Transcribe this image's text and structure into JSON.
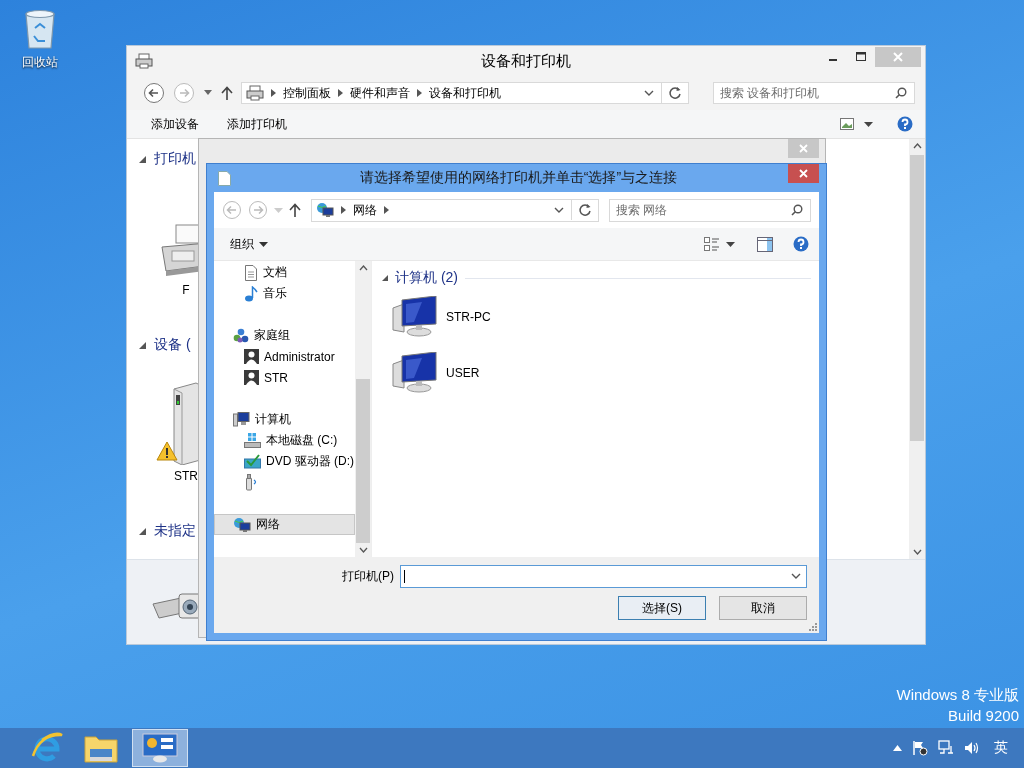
{
  "desktop": {
    "recycle_bin": {
      "label": "回收站"
    },
    "edition": "Windows 8 专业版",
    "build": "Build 9200"
  },
  "main_window": {
    "title": "设备和打印机",
    "breadcrumbs": [
      "控制面板",
      "硬件和声音",
      "设备和打印机"
    ],
    "search": {
      "placeholder": "搜索 设备和打印机"
    },
    "toolbar": [
      "添加设备",
      "添加打印机"
    ],
    "groups": [
      {
        "title": "打印机",
        "expanded": true,
        "items": [
          {
            "kind": "fax",
            "label": "F"
          }
        ]
      },
      {
        "title": "设备 (",
        "expanded": true,
        "items": [
          {
            "kind": "drive",
            "label": "STR",
            "warning": true
          }
        ]
      },
      {
        "title": "未指定",
        "expanded": true
      }
    ]
  },
  "dialog": {
    "title": "请选择希望使用的网络打印机并单击“选择”与之连接",
    "address": [
      "网络"
    ],
    "search": {
      "placeholder": "搜索 网络"
    },
    "organize": "组织",
    "nav_tree": [
      {
        "kind": "libraries",
        "children": [
          {
            "kind": "documents",
            "label": "文档",
            "selected": false
          },
          {
            "kind": "music",
            "label": "音乐",
            "selected": false
          }
        ]
      },
      {
        "kind": "homegroup",
        "label": "家庭组",
        "selected": false,
        "children": [
          {
            "kind": "user",
            "label": "Administrator",
            "selected": false
          },
          {
            "kind": "user",
            "label": "STR",
            "selected": false
          }
        ]
      },
      {
        "kind": "computer",
        "label": "计算机",
        "selected": false,
        "children": [
          {
            "kind": "disk",
            "label": "本地磁盘 (C:)",
            "selected": false
          },
          {
            "kind": "dvd",
            "label": "DVD 驱动器 (D:)",
            "selected": false
          },
          {
            "kind": "usb",
            "selected": false
          }
        ]
      },
      {
        "kind": "network",
        "label": "网络",
        "selected": true
      }
    ],
    "group": {
      "title": "计算机 (2)",
      "expanded": true
    },
    "computers": [
      {
        "name": "STR-PC"
      },
      {
        "name": "USER"
      }
    ],
    "printer_field": {
      "label": "打印机(P)"
    },
    "buttons": [
      {
        "label": "选择(S)",
        "default": true
      },
      {
        "label": "取消",
        "default": false
      }
    ]
  },
  "taskbar": {
    "apps": [
      {
        "kind": "browser",
        "selected": false
      },
      {
        "kind": "folder",
        "selected": false
      },
      {
        "kind": "control-panel",
        "selected": true
      }
    ],
    "language": "英"
  }
}
